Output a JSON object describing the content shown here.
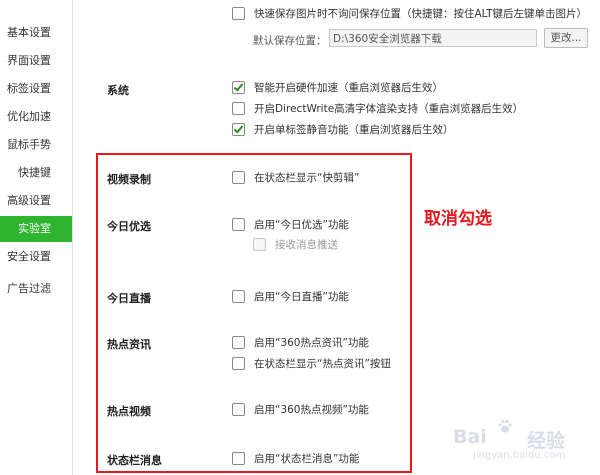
{
  "sidebar": {
    "items": [
      {
        "label": "基本设置"
      },
      {
        "label": "界面设置"
      },
      {
        "label": "标签设置"
      },
      {
        "label": "优化加速"
      },
      {
        "label": "鼠标手势"
      },
      {
        "label": "快捷键"
      },
      {
        "label": "高级设置"
      },
      {
        "label": "实验室"
      },
      {
        "label": "安全设置"
      },
      {
        "label": "广告过滤"
      }
    ],
    "active": "实验室"
  },
  "top": {
    "quick_save": {
      "label": "快速保存图片时不询问保存位置（快捷键：按住ALT键后左键单击图片）",
      "checked": false
    },
    "save_location_label": "默认保存位置：",
    "save_location_value": "D:\\360安全浏览器下载",
    "change_button": "更改..."
  },
  "system": {
    "label": "系统",
    "options": [
      {
        "label": "智能开启硬件加速（重启浏览器后生效）",
        "checked": true
      },
      {
        "label": "开启DirectWrite高清字体渲染支持（重启浏览器后生效）",
        "checked": false
      },
      {
        "label": "开启单标签静音功能（重启浏览器后生效）",
        "checked": true
      }
    ]
  },
  "features": {
    "video_record": {
      "label": "视频录制",
      "option": "在状态栏显示“快剪辑”",
      "checked": false
    },
    "today_pick": {
      "label": "今日优选",
      "option": "启用“今日优选”功能",
      "checked": false,
      "sub_option": "接收消息推送",
      "sub_checked": false
    },
    "today_live": {
      "label": "今日直播",
      "option": "启用“今日直播”功能",
      "checked": false
    },
    "hot_news": {
      "label": "热点资讯",
      "options": [
        {
          "label": "启用“360热点资讯”功能",
          "checked": false
        },
        {
          "label": "在状态栏显示“热点资讯”按钮",
          "checked": false
        }
      ]
    },
    "hot_video": {
      "label": "热点视频",
      "option": "启用“360热点视频”功能",
      "checked": false
    },
    "status_msg": {
      "label": "状态栏消息",
      "option": "启用“状态栏消息”功能",
      "checked": false
    }
  },
  "annotation": {
    "text": "取消勾选",
    "color": "#e8181d"
  },
  "watermark": {
    "brand": "Bai",
    "cn": "经验",
    "url": "jingyan.baidu.com"
  },
  "colors": {
    "active_sidebar": "#2fb42f",
    "highlight": "#e8181d",
    "check": "#2a8a2a"
  }
}
